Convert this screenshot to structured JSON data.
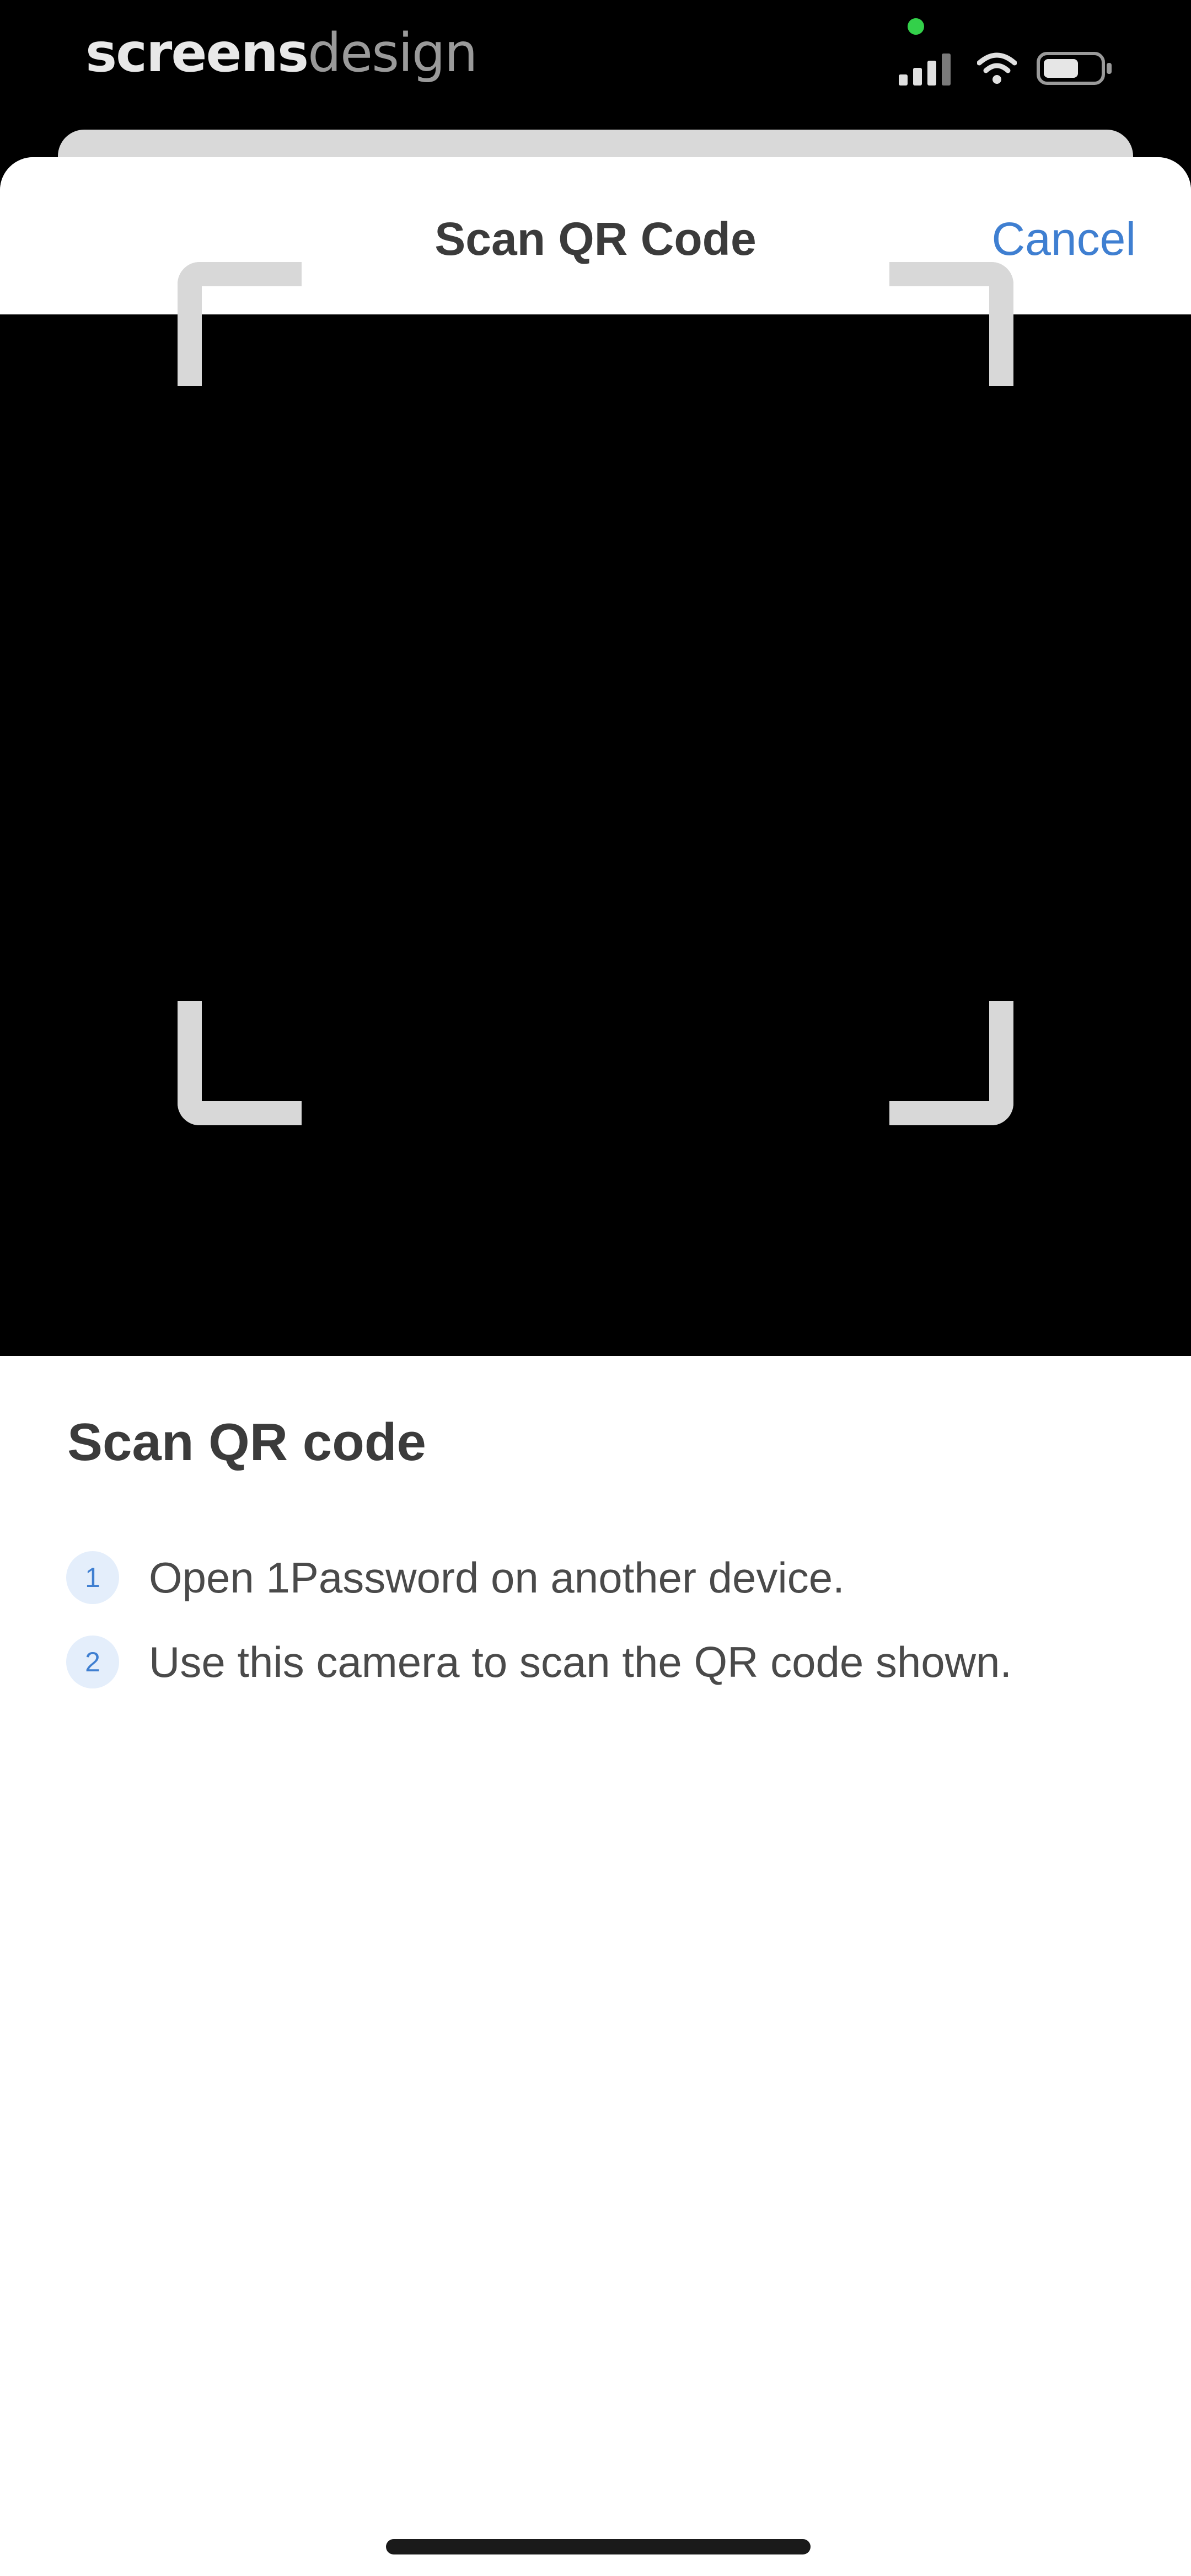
{
  "status_bar": {
    "brand_strong": "screens",
    "brand_light": "design"
  },
  "nav": {
    "title": "Scan QR Code",
    "cancel_label": "Cancel"
  },
  "instructions": {
    "title": "Scan QR code",
    "steps": [
      {
        "number": "1",
        "text": "Open 1Password on another device."
      },
      {
        "number": "2",
        "text": "Use this camera to scan the QR code shown."
      }
    ]
  },
  "colors": {
    "accent": "#3f7fd1",
    "privacy_indicator": "#33d04a",
    "viewfinder_background": "#000000",
    "frame_corners": "#d8d8d8"
  },
  "icons": {
    "signal": "cellular-signal-icon",
    "wifi": "wifi-icon",
    "battery": "battery-icon"
  }
}
